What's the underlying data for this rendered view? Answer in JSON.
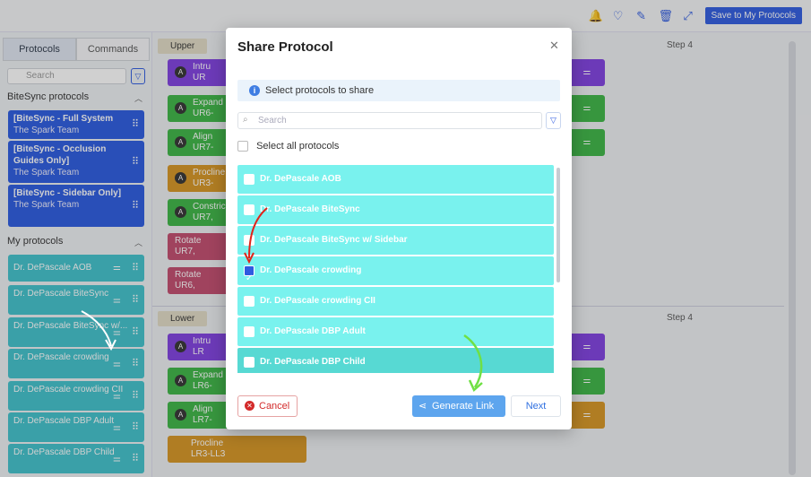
{
  "topbar": {
    "icons": [
      "bell-icon",
      "heart-icon",
      "edit-icon",
      "trash-icon",
      "expand-icon"
    ],
    "save_label": "Save to My Protocols"
  },
  "left": {
    "tabs": [
      "Protocols",
      "Commands"
    ],
    "search_placeholder": "Search",
    "bitesync_title": "BiteSync protocols",
    "bitesync": [
      {
        "title": "[BiteSync - Full System",
        "sub": "The Spark Team"
      },
      {
        "title": "[BiteSync - Occlusion Guides Only]",
        "sub": "The Spark Team"
      },
      {
        "title": "[BiteSync - Sidebar Only]",
        "sub": "The Spark Team"
      }
    ],
    "my_title": "My protocols",
    "mine": [
      "Dr. DePascale AOB",
      "Dr. DePascale BiteSync",
      "Dr. DePascale BiteSync w/...",
      "Dr. DePascale crowding",
      "Dr. DePascale crowding CII",
      "Dr. DePascale DBP Adult",
      "Dr. DePascale DBP Child"
    ]
  },
  "workspace": {
    "upper_label": "Upper",
    "lower_label": "Lower",
    "step_label": "Step 4",
    "upper_cards": [
      {
        "title": "Intru",
        "sub": "UR",
        "color": "purple"
      },
      {
        "title": "Expand",
        "sub": "UR6-",
        "color": "green"
      },
      {
        "title": "Align",
        "sub": "UR7-",
        "color": "green"
      },
      {
        "title": "Procline",
        "sub": "UR3-",
        "color": "orange"
      },
      {
        "title": "Constric",
        "sub": "UR7,",
        "color": "green"
      },
      {
        "title": "Rotate",
        "sub": "UR7,",
        "color": "pink"
      },
      {
        "title": "Rotate",
        "sub": "UR6,",
        "color": "pink"
      }
    ],
    "lower_cards": [
      {
        "title": "Intru",
        "sub": "LR",
        "color": "purple"
      },
      {
        "title": "Expand",
        "sub": "LR6-",
        "color": "green"
      },
      {
        "title": "Align",
        "sub": "LR7-",
        "color": "green"
      },
      {
        "title": "Procline",
        "sub": "LR3-LL3",
        "color": "orange"
      }
    ]
  },
  "modal": {
    "title": "Share Protocol",
    "info": "Select protocols to share",
    "search_placeholder": "Search",
    "select_all": "Select all protocols",
    "protocols": [
      {
        "name": "Dr. DePascale AOB",
        "checked": false
      },
      {
        "name": "Dr. DePascale BiteSync",
        "checked": false
      },
      {
        "name": "Dr. DePascale BiteSync w/ Sidebar",
        "checked": false
      },
      {
        "name": "Dr. DePascale crowding",
        "checked": true
      },
      {
        "name": "Dr. DePascale crowding CII",
        "checked": false
      },
      {
        "name": "Dr. DePascale DBP Adult",
        "checked": false
      },
      {
        "name": "Dr. DePascale DBP Child",
        "checked": false
      }
    ],
    "cancel_label": "Cancel",
    "generate_label": "Generate Link",
    "next_label": "Next"
  },
  "colors": {
    "primary": "#2f5be0",
    "protocol_item": "#79f2ee",
    "cancel_red": "#d32a2a",
    "generate_blue": "#5da5ee"
  }
}
